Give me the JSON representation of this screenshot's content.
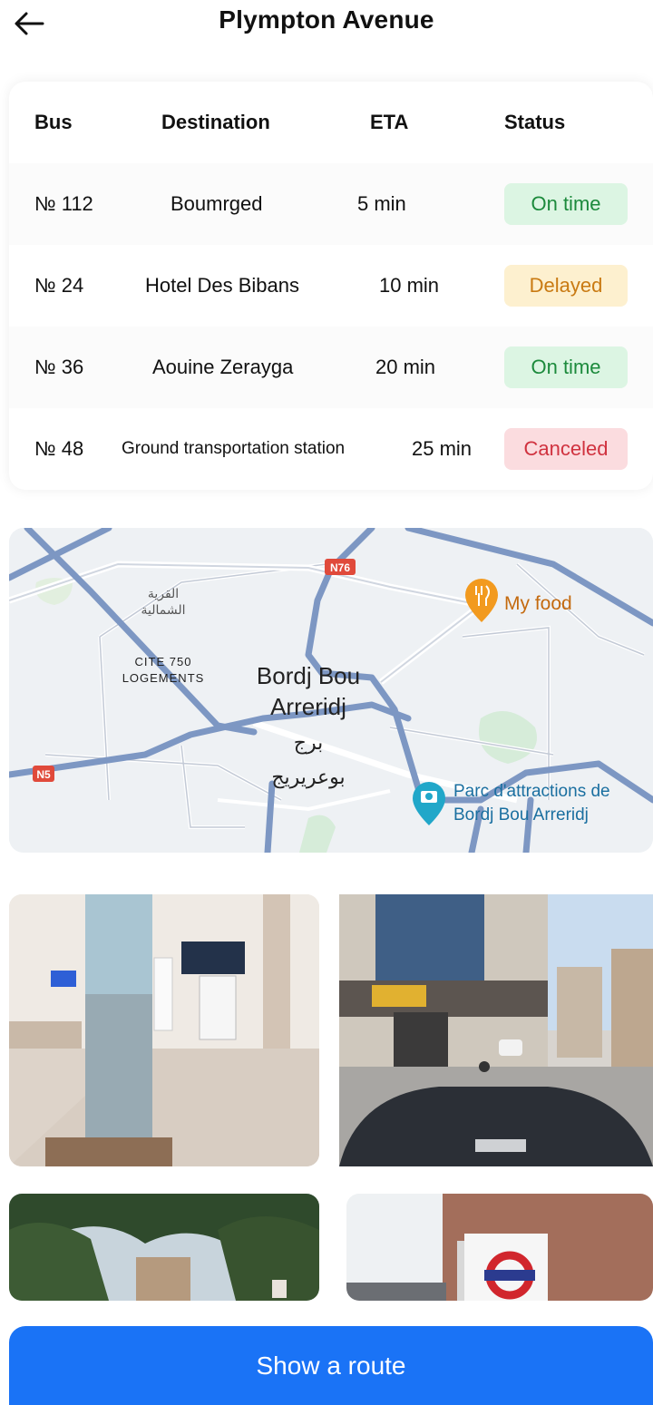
{
  "header": {
    "title": "Plympton Avenue"
  },
  "table": {
    "columns": [
      "Bus",
      "Destination",
      "ETA",
      "Status"
    ],
    "rows": [
      {
        "bus": "№ 112",
        "destination": "Boumrged",
        "eta": "5 min",
        "status": "On time"
      },
      {
        "bus": "№ 24",
        "destination": "Hotel Des Bibans",
        "eta": "10 min",
        "status": "Delayed"
      },
      {
        "bus": "№ 36",
        "destination": "Aouine Zerayga",
        "eta": "20 min",
        "status": "On time"
      },
      {
        "bus": "№ 48",
        "destination": "Ground transportation station",
        "eta": "25 min",
        "status": "Canceled"
      }
    ]
  },
  "status_colors": {
    "on_time": {
      "bg": "#dcf5e3",
      "fg": "#1c8a3c"
    },
    "delayed": {
      "bg": "#fdf0cf",
      "fg": "#c97a12"
    },
    "canceled": {
      "bg": "#fbdcdf",
      "fg": "#d0323f"
    }
  },
  "map": {
    "city_en": "Bordj Bou Arreridj",
    "city_en_line1": "Bordj Bou",
    "city_en_line2": "Arreridj",
    "city_ar_line1": "برج",
    "city_ar_line2": "بوعريريج",
    "north_ar_line1": "القرية",
    "north_ar_line2": "الشمالية",
    "district_line1": "CITE 750",
    "district_line2": "LOGEMENTS",
    "poi_food": "My food",
    "poi_park_line1": "Parc d'attractions de",
    "poi_park_line2": "Bordj Bou Arreridj",
    "road_n76": "N76",
    "road_n5": "N5"
  },
  "actions": {
    "show_route": "Show a route"
  },
  "colors": {
    "accent": "#1a73f6",
    "road": "#7d97c3"
  }
}
